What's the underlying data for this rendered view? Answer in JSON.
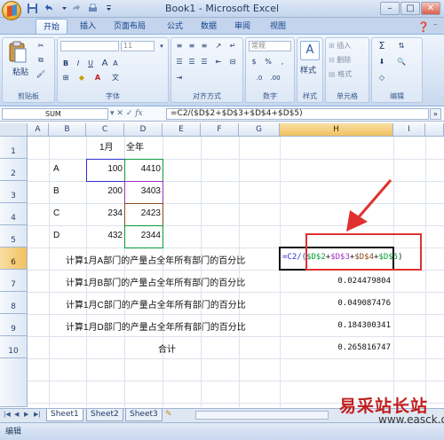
{
  "window": {
    "title": "Book1 - Microsoft Excel"
  },
  "tabs": [
    "开始",
    "插入",
    "页面布局",
    "公式",
    "数据",
    "审阅",
    "视图"
  ],
  "ribbon": {
    "clipboard": {
      "paste": "粘贴",
      "label": "剪贴板"
    },
    "font": {
      "size": "11",
      "label": "字体"
    },
    "alignment": {
      "label": "对齐方式"
    },
    "number": {
      "format": "常规",
      "label": "数字"
    },
    "styles": {
      "label": "样式"
    },
    "cells": {
      "insert": "插入",
      "delete": "删除",
      "format": "格式",
      "label": "单元格"
    },
    "editing": {
      "label": "编辑"
    }
  },
  "formula_bar": {
    "name_box": "SUM",
    "fx": "fx",
    "formula": "=C2/($D$2+$D$3+$D$4+$D$5)"
  },
  "columns": [
    "A",
    "B",
    "C",
    "D",
    "E",
    "F",
    "G",
    "H",
    "I"
  ],
  "rows": [
    "1",
    "2",
    "3",
    "4",
    "5",
    "6",
    "7",
    "8",
    "9",
    "10"
  ],
  "cells": {
    "C1": "1月",
    "D1": "全年",
    "B2": "A",
    "C2": "100",
    "D2": "4410",
    "B3": "B",
    "C3": "200",
    "D3": "3403",
    "B4": "C",
    "C4": "234",
    "D4": "2423",
    "B5": "D",
    "C5": "432",
    "D5": "2344",
    "B6": "计算1月A部门的产量占全年所有部门的百分比",
    "B7": "计算1月B部门的产量占全年所有部门的百分比",
    "H7": "0.024479804",
    "B8": "计算1月C部门的产量占全年所有部门的百分比",
    "H8": "0.049087476",
    "B9": "计算1月D部门的产量占全年所有部门的百分比",
    "H9": "0.184300341",
    "D10": "合计",
    "H10": "0.265816747"
  },
  "edit_formula": {
    "p1": "=C2/(",
    "p2": "$D$2",
    "p3": "+",
    "p4": "$D$3",
    "p5": "+",
    "p6": "$D$4",
    "p7": "+",
    "p8": "$D$5",
    "p9": ")"
  },
  "sheets": [
    "Sheet1",
    "Sheet2",
    "Sheet3"
  ],
  "status": {
    "mode": "编辑"
  },
  "watermark": {
    "text": "易采站长站",
    "url": "www.easck.com"
  },
  "colors": {
    "accent_red": "#e03030",
    "ref_blue": "#3030d0",
    "ref_green": "#0a9a3a",
    "ref_purple": "#a030c0",
    "ref_brown": "#8a4a1a"
  }
}
